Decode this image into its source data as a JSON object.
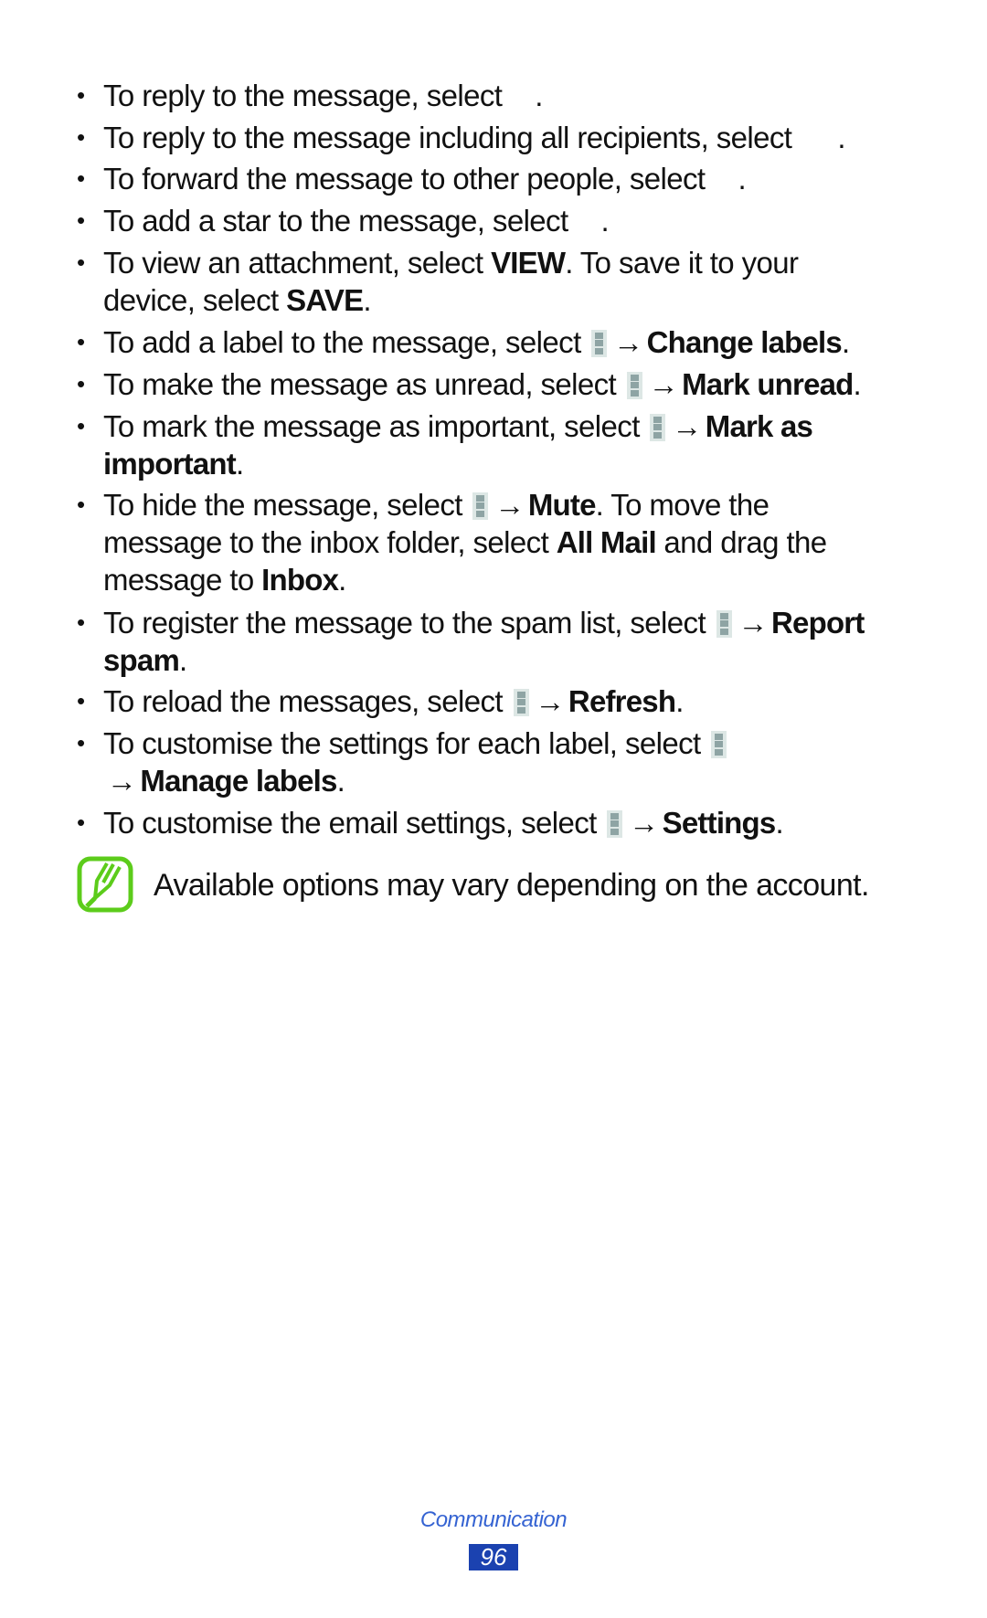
{
  "items": [
    {
      "pre": "To reply to the message, select",
      "icon": "reply-icon",
      "post": "."
    },
    {
      "pre": "To reply to the message including all recipients, select",
      "icon": "reply-all-icon",
      "post": "."
    },
    {
      "pre": "To forward the message to other people, select",
      "icon": "forward-icon",
      "post": "."
    },
    {
      "pre": "To add a star to the message, select",
      "icon": "star-icon",
      "post": "."
    },
    {
      "a": "To view an attachment, select ",
      "b1": "VIEW",
      "c": ". To save it to your device, select ",
      "b2": "SAVE",
      "d": "."
    },
    {
      "pre": "To add a label to the message, select",
      "arrow": "→",
      "bold": "Change labels",
      "post": "."
    },
    {
      "pre": "To make the message as unread, select",
      "arrow": "→",
      "bold": "Mark unread",
      "post": "."
    },
    {
      "pre": "To mark the message as important, select",
      "arrow": "→",
      "bold": "Mark as important",
      "post": "."
    },
    {
      "pre": "To hide the message, select",
      "arrow": "→",
      "bold": "Mute",
      "mid": ". To move the message to the inbox folder, select ",
      "bold2": "All Mail",
      "mid2": " and drag the message to ",
      "bold3": "Inbox",
      "post": "."
    },
    {
      "pre": "To register the message to the spam list, select",
      "arrow": "→",
      "bold": "Report spam",
      "post": "."
    },
    {
      "pre": "To reload the messages, select",
      "arrow": "→",
      "bold": "Refresh",
      "post": "."
    },
    {
      "pre": "To customise the settings for each label, select",
      "arrow": "→",
      "bold": "Manage labels",
      "post": "."
    },
    {
      "pre": "To customise the email settings, select",
      "arrow": "→",
      "bold": "Settings",
      "post": "."
    }
  ],
  "bullet": "•",
  "note": {
    "text": "Available options may vary depending on the account.",
    "icon": "note-pencil-icon",
    "color": "#5ccc1b"
  },
  "footer": {
    "section": "Communication",
    "page": "96",
    "section_color": "#3563d2",
    "page_bg": "#1b42b0"
  }
}
